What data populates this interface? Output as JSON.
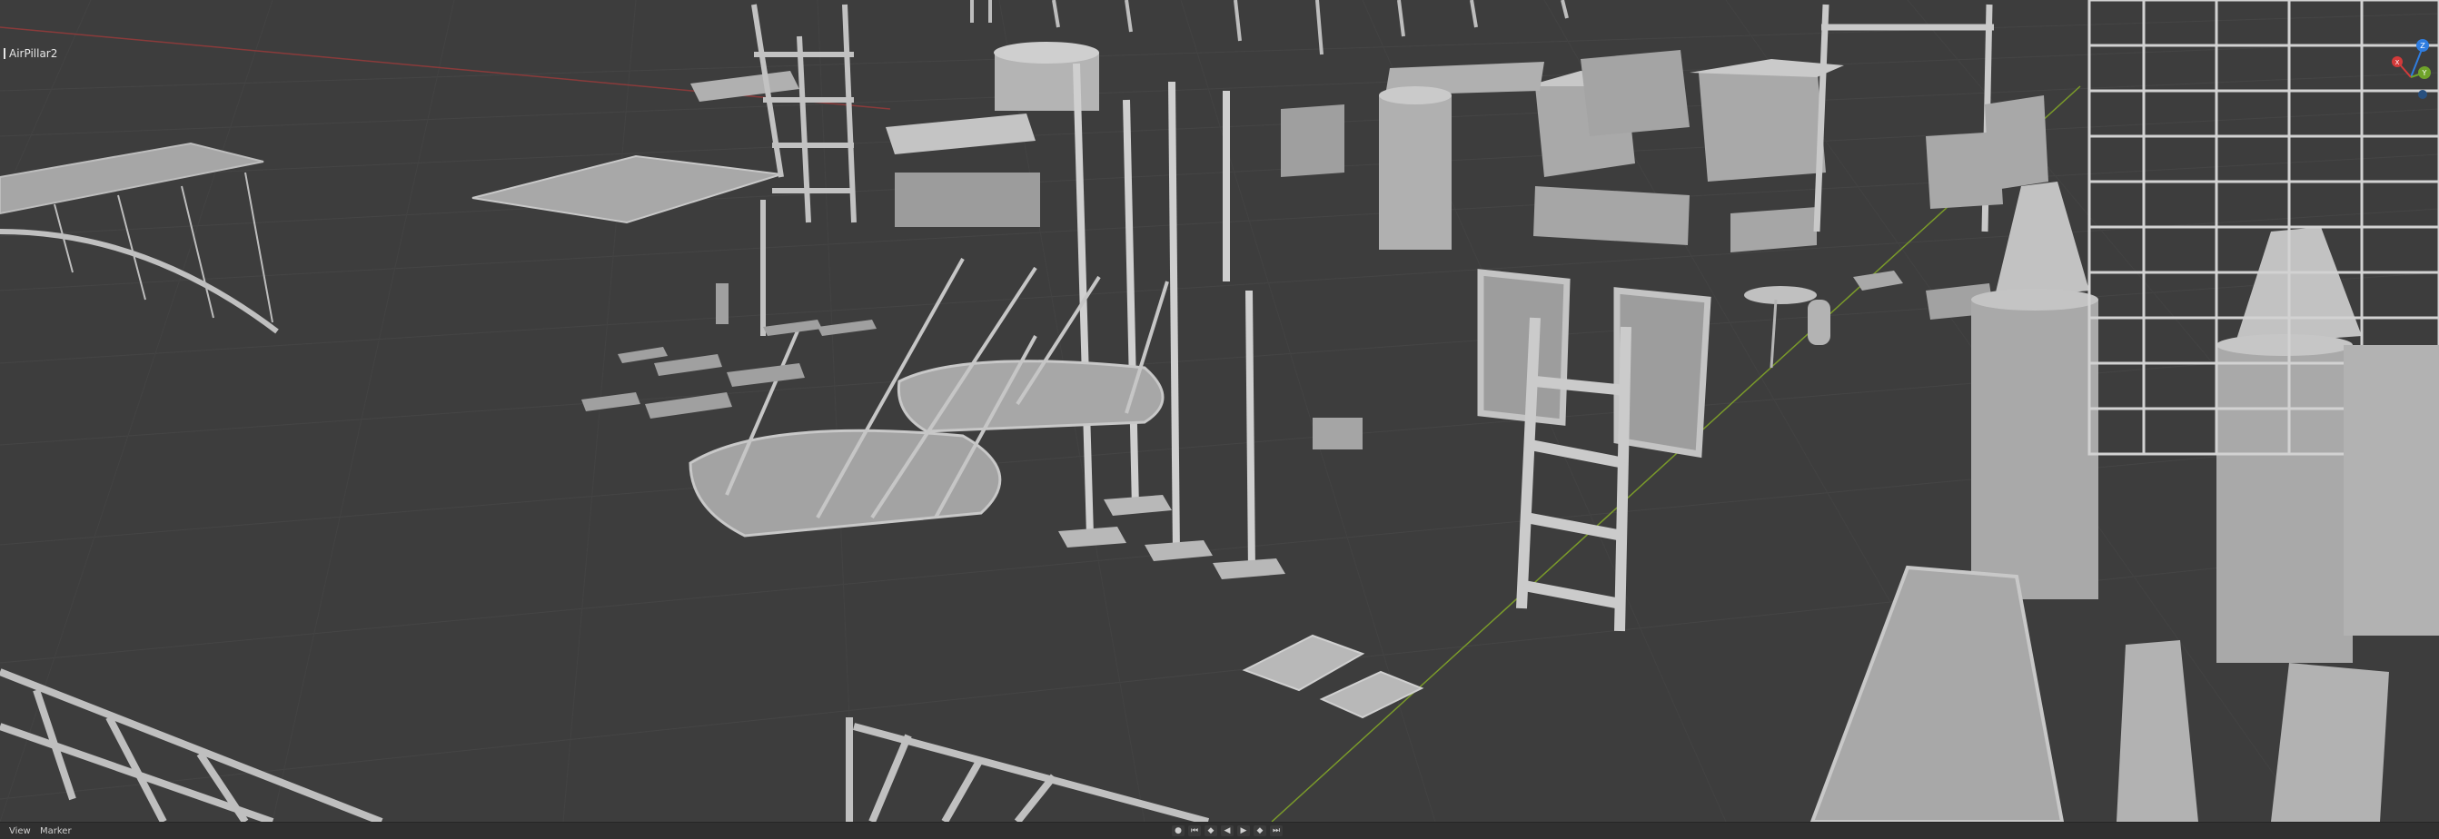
{
  "viewport": {
    "active_object": "AirPillar2"
  },
  "gizmo": {
    "z_label": "Z",
    "y_label": "Y",
    "x_label": "X"
  },
  "timeline": {
    "menu_view": "View",
    "menu_marker": "Marker",
    "transport": [
      "record-icon",
      "jump-start-icon",
      "prev-keyframe-icon",
      "play-reverse-icon",
      "play-icon",
      "next-keyframe-icon",
      "jump-end-icon"
    ]
  },
  "colors": {
    "background": "#3d3d3d",
    "grid_line": "#4a4a4a",
    "model_light": "#bdbdbd",
    "model_mid": "#9a9a9a",
    "model_dark": "#6e6e6e",
    "x_axis": "#8a3b3b",
    "y_axis": "#7a9a2a",
    "gizmo_z": "#2f7de0",
    "gizmo_y": "#6fa32a",
    "gizmo_x": "#d33a3a"
  }
}
